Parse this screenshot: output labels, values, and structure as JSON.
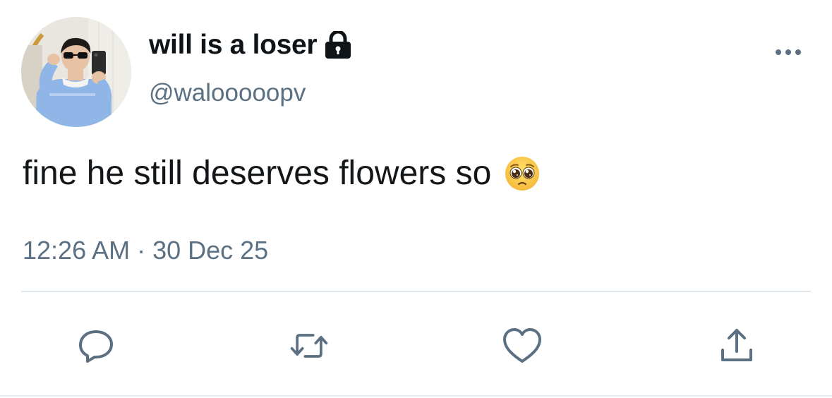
{
  "user": {
    "display_name": "will is a loser",
    "handle": "@walooooopv",
    "protected_icon": "lock-icon",
    "avatar_icon": "avatar-photo"
  },
  "tweet": {
    "text": "fine he still deserves flowers so",
    "emoji": "pleading-face-emoji",
    "timestamp": "12:26 AM · 30 Dec 25"
  },
  "actions": {
    "reply_icon": "reply-icon",
    "retweet_icon": "retweet-icon",
    "like_icon": "heart-icon",
    "share_icon": "share-icon",
    "more_icon": "more-icon"
  },
  "colors": {
    "text_primary": "#14171a",
    "text_secondary": "#5b7083",
    "icon": "#5b7083",
    "divider": "#e1e8ed",
    "avatar_sweater": "#8fb6e6"
  }
}
